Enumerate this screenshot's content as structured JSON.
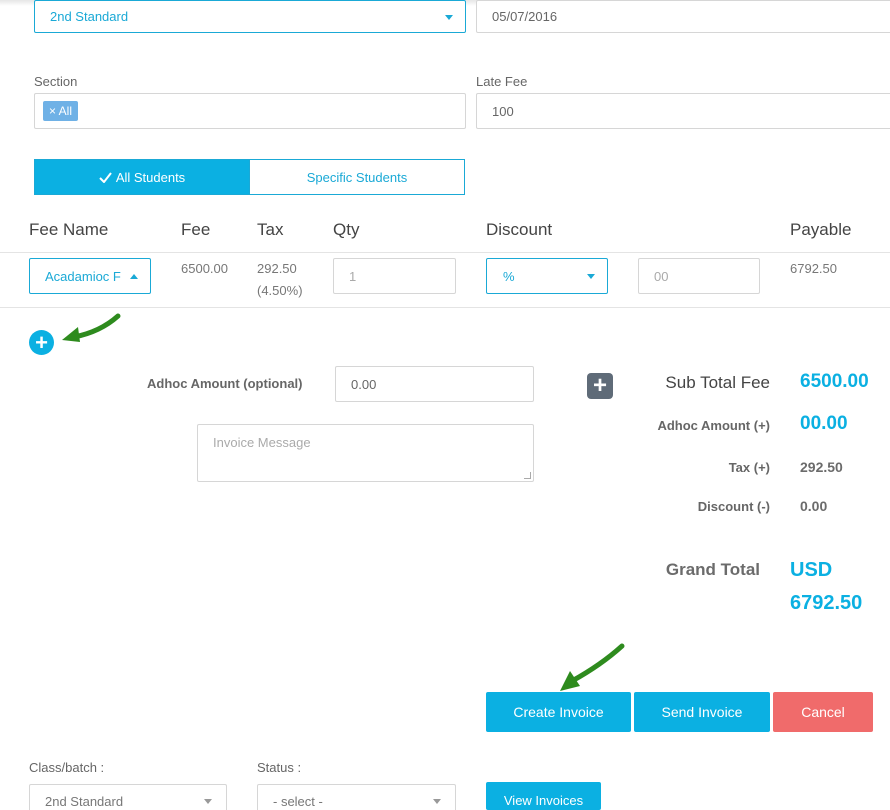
{
  "top": {
    "class_select": "2nd Standard",
    "date_value": "05/07/2016"
  },
  "section": {
    "label": "Section",
    "tag": "× All"
  },
  "late_fee": {
    "label": "Late Fee",
    "value": "100"
  },
  "students_toggle": {
    "all": "All Students",
    "specific": "Specific Students"
  },
  "fee_table": {
    "headers": [
      "Fee Name",
      "Fee",
      "Tax",
      "Qty",
      "Discount",
      "Payable"
    ],
    "row": {
      "fee_name": "Acadamioc F",
      "fee": "6500.00",
      "tax": "292.50",
      "tax_pct": "(4.50%)",
      "qty": "1",
      "discount_type": "%",
      "discount_value": "00",
      "payable": "6792.50"
    }
  },
  "adhoc": {
    "label": "Adhoc Amount (optional)",
    "placeholder": "0.00"
  },
  "invoice_message": {
    "placeholder": "Invoice Message"
  },
  "summary": {
    "sub_total_label": "Sub Total Fee",
    "sub_total_value": "6500.00",
    "adhoc_label": "Adhoc Amount (+)",
    "adhoc_value": "00.00",
    "tax_label": "Tax (+)",
    "tax_value": "292.50",
    "discount_label": "Discount (-)",
    "discount_value": "0.00",
    "grand_total_label": "Grand Total",
    "grand_total_currency": "USD",
    "grand_total_value": "6792.50"
  },
  "actions": {
    "create": "Create Invoice",
    "send": "Send Invoice",
    "cancel": "Cancel"
  },
  "filters": {
    "class_label": "Class/batch :",
    "class_value": "2nd Standard",
    "status_label": "Status :",
    "status_value": "- select -",
    "view_button": "View Invoices"
  },
  "colors": {
    "accent": "#0bb0e2",
    "cancel": "#f06b6b",
    "arrow": "#2e8b1e"
  },
  "icons": [
    "chevron-down-icon",
    "chevron-up-icon",
    "check-icon",
    "plus-circle-icon",
    "plus-square-icon",
    "annotation-arrow-icon"
  ]
}
